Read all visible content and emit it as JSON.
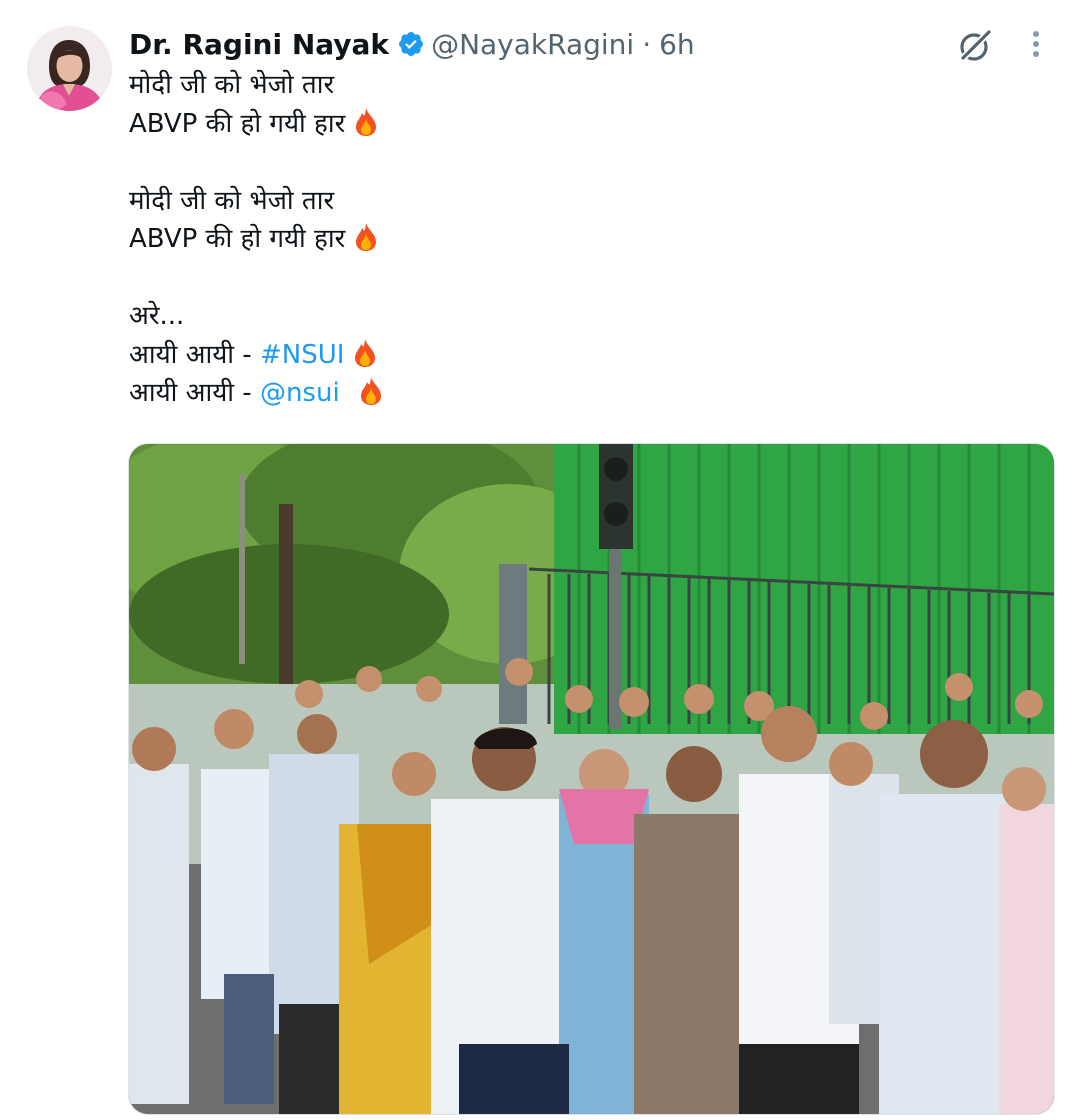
{
  "tweet": {
    "author_name": "Dr. Ragini Nayak",
    "handle": "@NayakRagini",
    "separator": "·",
    "time": "6h",
    "lines": {
      "l1": "मोदी जी को भेजो तार",
      "l2": "ABVP की हो गयी हार",
      "l3": "मोदी जी को भेजो तार",
      "l4": "ABVP की हो गयी हार",
      "l5": "अरे...",
      "l6_prefix": "आयी आयी - ",
      "l6_link": "#NSUI",
      "l7_prefix": "आयी आयी - ",
      "l7_link": "@nsui"
    }
  },
  "icons": {
    "verified": "verified-badge-icon",
    "grok": "grok-icon",
    "more": "more-vertical-icon",
    "emoji": "fire-emoji"
  },
  "colors": {
    "text": "#0f1419",
    "secondary": "#536471",
    "link": "#1d9bf0",
    "verified": "#1d9bf0"
  }
}
